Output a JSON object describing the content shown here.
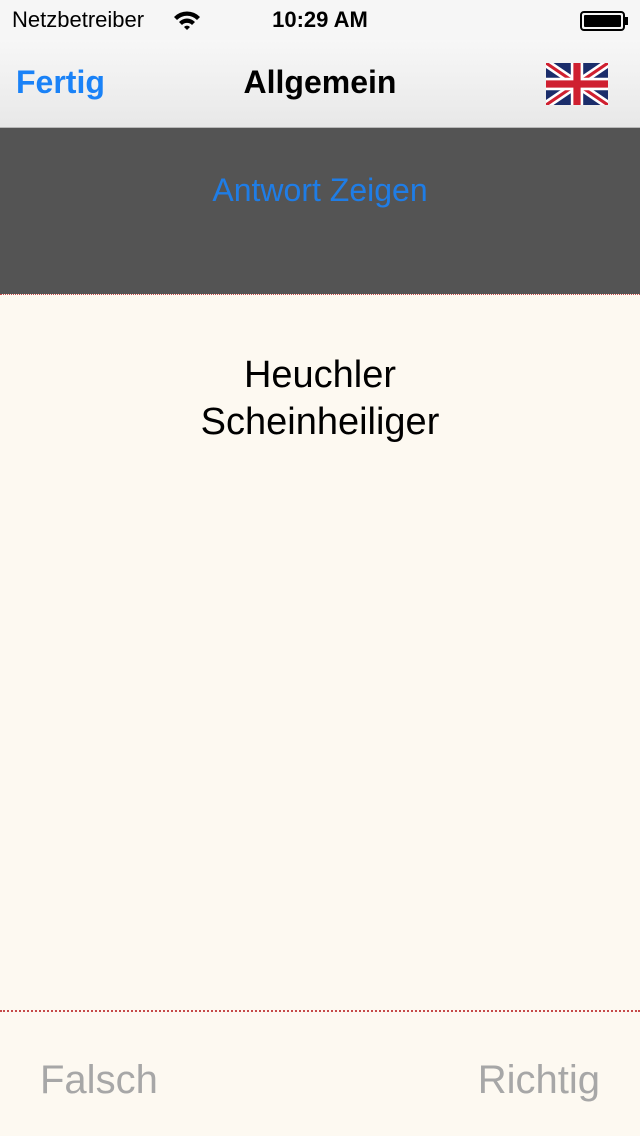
{
  "status_bar": {
    "carrier": "Netzbetreiber",
    "time": "10:29 AM",
    "icons": [
      "wifi-icon",
      "battery-icon"
    ]
  },
  "nav": {
    "done_label": "Fertig",
    "title": "Allgemein",
    "language_icon": "uk-flag-icon"
  },
  "answer_panel": {
    "show_answer_label": "Antwort Zeigen"
  },
  "card": {
    "lines": [
      "Heuchler",
      "Scheinheiliger"
    ]
  },
  "footer": {
    "wrong_label": "Falsch",
    "right_label": "Richtig"
  },
  "colors": {
    "accent": "#1a82f7",
    "answer_panel_bg": "#545454",
    "card_bg": "#fdf9f1",
    "divider": "#c64a4a",
    "inactive_text": "#a7a7a7"
  }
}
